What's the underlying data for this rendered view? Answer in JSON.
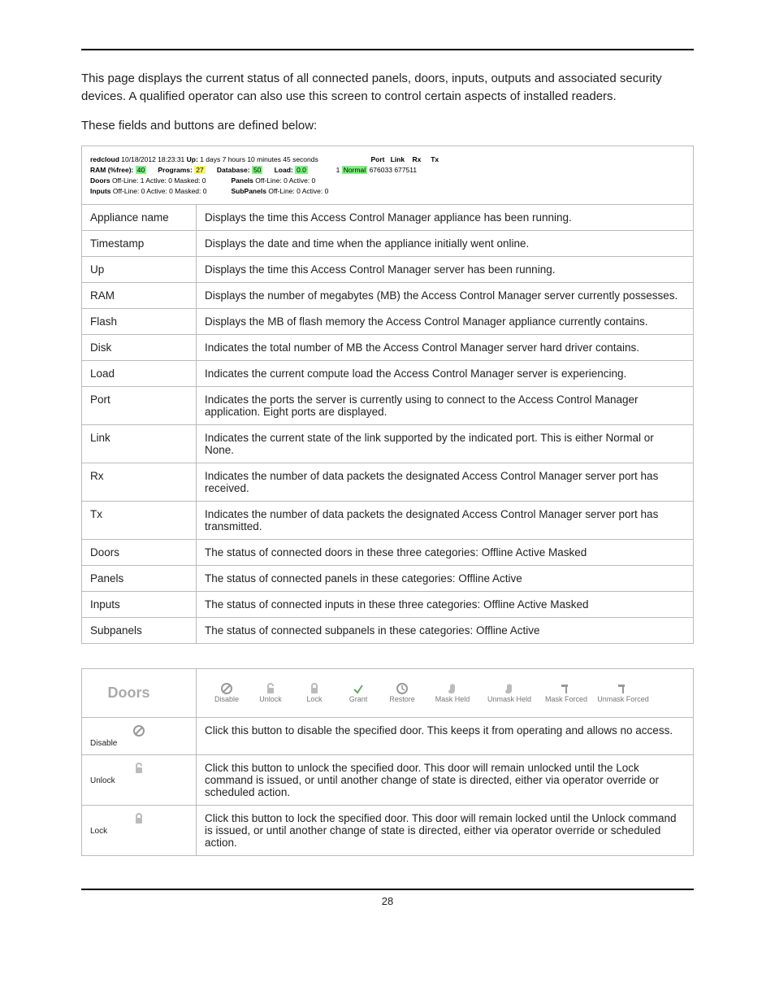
{
  "intro": {
    "p1": "This page displays the current status of all connected panels, doors, inputs, outputs and associated security devices. A qualified operator can also use this screen to control certain aspects of installed readers.",
    "p2": "These fields and buttons are defined below:"
  },
  "status_header": {
    "host": "redcloud",
    "timestamp": "10/18/2012 18:23:31",
    "up_label": "Up:",
    "up_value": "1 days 7 hours 10 minutes 45 seconds",
    "port_hdr": "Port",
    "link_hdr": "Link",
    "rx_hdr": "Rx",
    "tx_hdr": "Tx",
    "ram_label": "RAM (%free):",
    "ram_value": "40",
    "programs_label": "Programs:",
    "programs_value": "27",
    "database_label": "Database:",
    "database_value": "50",
    "load_label": "Load:",
    "load_value": "0.0",
    "port_num": "1",
    "link_state": "Normal",
    "rx_value": "676033",
    "tx_value": "677511",
    "doors_label": "Doors",
    "doors_value": "Off-Line: 1 Active: 0 Masked: 0",
    "panels_label": "Panels",
    "panels_value": "Off-Line: 0 Active: 0",
    "inputs_label": "Inputs",
    "inputs_value": "Off-Line: 0 Active: 0 Masked: 0",
    "subpanels_label": "SubPanels",
    "subpanels_value": "Off-Line: 0 Active: 0"
  },
  "field_defs": [
    {
      "term": "Appliance name",
      "desc": "Displays the time this Access Control Manager appliance has been running."
    },
    {
      "term": "Timestamp",
      "desc": "Displays the date and time when the appliance initially went online."
    },
    {
      "term": "Up",
      "desc": "Displays the time this Access Control Manager server has been running."
    },
    {
      "term": "RAM",
      "desc": "Displays the number of megabytes (MB) the Access Control Manager server currently possesses."
    },
    {
      "term": "Flash",
      "desc": "Displays the MB of flash memory the Access Control Manager appliance currently contains."
    },
    {
      "term": "Disk",
      "desc": "Indicates the total number of MB the Access Control Manager server hard driver contains."
    },
    {
      "term": "Load",
      "desc": "Indicates the current compute load the Access Control Manager server is experiencing."
    },
    {
      "term": "Port",
      "desc": "Indicates the ports the server is currently using to connect to the Access Control Manager application. Eight ports are displayed."
    },
    {
      "term": "Link",
      "desc": "Indicates the current state of the link supported by the indicated port. This is either Normal or None."
    },
    {
      "term": "Rx",
      "desc": "Indicates the number of data packets the designated Access Control Manager server port has received."
    },
    {
      "term": "Tx",
      "desc": "Indicates the number of data packets the designated Access Control Manager server port has transmitted."
    },
    {
      "term": "Doors",
      "desc": "The status of connected doors in these three categories: Offline Active Masked"
    },
    {
      "term": "Panels",
      "desc": "The status of connected panels in these categories: Offline Active"
    },
    {
      "term": "Inputs",
      "desc": "The status of connected inputs in these three categories: Offline Active Masked"
    },
    {
      "term": "Subpanels",
      "desc": "The status of connected subpanels in these categories: Offline Active"
    }
  ],
  "doors_toolbar": {
    "title": "Doors",
    "buttons": [
      "Disable",
      "Unlock",
      "Lock",
      "Grant",
      "Restore",
      "Mask Held",
      "Unmask Held",
      "Mask Forced",
      "Unmask Forced"
    ]
  },
  "door_cmds": [
    {
      "label": "Disable",
      "desc": "Click this button to disable the specified door. This keeps it from operating and allows no access."
    },
    {
      "label": "Unlock",
      "desc": "Click this button to unlock the specified door. This door will remain unlocked until the Lock command is issued, or until another change of state is directed, either via operator override or scheduled action."
    },
    {
      "label": "Lock",
      "desc": "Click this button to lock the specified door. This door will remain locked until the Unlock command is issued, or until another change of state is directed, either via operator override or scheduled action."
    }
  ],
  "page_number": "28"
}
